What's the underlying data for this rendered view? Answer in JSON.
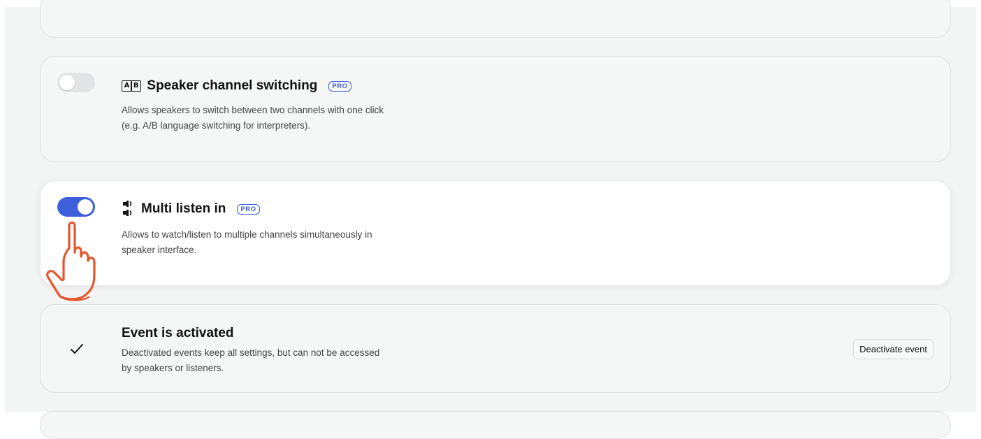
{
  "settings": {
    "speaker_switching": {
      "title": "Speaker channel switching",
      "badge": "PRO",
      "description": "Allows speakers to switch between two channels with one click (e.g. A/B language switching for interpreters).",
      "enabled": false,
      "icon": "ab-switch-icon",
      "icon_letters": [
        "A",
        "B"
      ]
    },
    "multi_listen": {
      "title": "Multi listen in",
      "badge": "PRO",
      "description": "Allows to watch/listen to multiple channels simultaneously in speaker interface.",
      "enabled": true,
      "icon": "multi-speaker-icon"
    }
  },
  "event": {
    "title": "Event is activated",
    "description": "Deactivated events keep all settings, but can not be accessed by speakers or listeners.",
    "button_label": "Deactivate event",
    "status_icon": "check-icon"
  },
  "colors": {
    "accent": "#3d5fdc",
    "pointer_annotation": "#e4572e"
  },
  "annotation": {
    "icon": "pointing-hand-icon"
  }
}
